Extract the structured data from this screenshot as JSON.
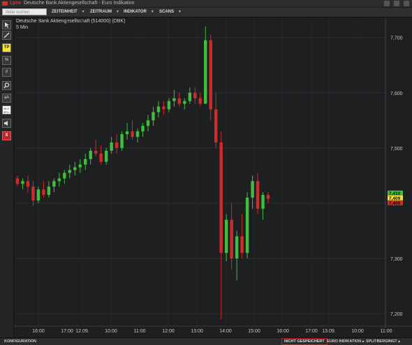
{
  "app": {
    "brand": "Lynx",
    "window_title": "Deutsche Bank Aktiengesellschaft - Euro Indikation"
  },
  "toolbar": {
    "search_placeholder": "Aktie suchen",
    "menus": [
      {
        "label": "ZEITEINHEIT"
      },
      {
        "label": "ZEITRAUM"
      },
      {
        "label": "INDIKATOR"
      },
      {
        "label": "SCANS"
      }
    ]
  },
  "sidebar": {
    "buttons": [
      {
        "label": "",
        "icon": "cursor-icon"
      },
      {
        "label": "",
        "icon": "line-tool-icon"
      },
      {
        "label": "TP",
        "icon": "tp-icon",
        "highlight": "#f4e23a"
      },
      {
        "label": "%",
        "icon": "percent-tool-icon"
      },
      {
        "label": "//",
        "icon": "parallel-lines-icon"
      },
      {
        "label": "",
        "icon": "zoom-icon"
      },
      {
        "label": "aA",
        "icon": "text-tool-icon"
      },
      {
        "label": "BUY SELL",
        "icon": "buy-sell-icon"
      },
      {
        "label": "",
        "icon": "sound-icon"
      },
      {
        "label": "X",
        "icon": "close-icon",
        "highlight": "#c0272d"
      }
    ]
  },
  "chart": {
    "title": "Deutsche Bank Aktiengesellschaft (514000) (DBK)",
    "subtitle": "5 Min"
  },
  "chart_data": {
    "type": "candlestick",
    "ylim": [
      7.18,
      7.735
    ],
    "y_ticks": [
      7.2,
      7.3,
      7.4,
      7.5,
      7.6,
      7.7
    ],
    "y_tick_labels": [
      "7,200",
      "7,300",
      "7,400",
      "7,500",
      "7,600",
      "7,700"
    ],
    "x_tick_labels": [
      "16:00",
      "17:00",
      "12.09.",
      "10:00",
      "11:00",
      "12:00",
      "13:00",
      "14:00",
      "15:00",
      "16:00",
      "17:00",
      "13.09.",
      "10:00",
      "11:00"
    ],
    "price_labels": [
      {
        "text": "7,410",
        "color": "#3fbf3f"
      },
      {
        "text": "7,409",
        "color": "#f0e030"
      },
      {
        "text": "7,408",
        "color": "#d22a2a"
      }
    ],
    "up_color": "#3fbf3f",
    "down_color": "#d22a2a",
    "candles": [
      [
        7.445,
        7.45,
        7.43,
        7.435
      ],
      [
        7.435,
        7.445,
        7.425,
        7.44
      ],
      [
        7.44,
        7.45,
        7.42,
        7.43
      ],
      [
        7.43,
        7.44,
        7.395,
        7.405
      ],
      [
        7.405,
        7.43,
        7.4,
        7.425
      ],
      [
        7.425,
        7.44,
        7.41,
        7.415
      ],
      [
        7.415,
        7.44,
        7.41,
        7.43
      ],
      [
        7.43,
        7.445,
        7.42,
        7.44
      ],
      [
        7.44,
        7.455,
        7.43,
        7.445
      ],
      [
        7.445,
        7.46,
        7.435,
        7.455
      ],
      [
        7.455,
        7.47,
        7.445,
        7.46
      ],
      [
        7.46,
        7.475,
        7.45,
        7.465
      ],
      [
        7.465,
        7.48,
        7.455,
        7.47
      ],
      [
        7.47,
        7.49,
        7.46,
        7.48
      ],
      [
        7.48,
        7.5,
        7.47,
        7.495
      ],
      [
        7.495,
        7.515,
        7.485,
        7.49
      ],
      [
        7.49,
        7.505,
        7.47,
        7.475
      ],
      [
        7.475,
        7.5,
        7.47,
        7.495
      ],
      [
        7.495,
        7.52,
        7.49,
        7.51
      ],
      [
        7.51,
        7.525,
        7.49,
        7.5
      ],
      [
        7.5,
        7.53,
        7.495,
        7.525
      ],
      [
        7.525,
        7.545,
        7.515,
        7.53
      ],
      [
        7.53,
        7.55,
        7.515,
        7.52
      ],
      [
        7.52,
        7.535,
        7.51,
        7.53
      ],
      [
        7.53,
        7.545,
        7.52,
        7.54
      ],
      [
        7.54,
        7.56,
        7.53,
        7.55
      ],
      [
        7.55,
        7.575,
        7.54,
        7.565
      ],
      [
        7.565,
        7.585,
        7.555,
        7.575
      ],
      [
        7.575,
        7.585,
        7.56,
        7.57
      ],
      [
        7.57,
        7.59,
        7.565,
        7.585
      ],
      [
        7.585,
        7.605,
        7.575,
        7.59
      ],
      [
        7.59,
        7.6,
        7.575,
        7.58
      ],
      [
        7.58,
        7.59,
        7.57,
        7.585
      ],
      [
        7.585,
        7.61,
        7.58,
        7.6
      ],
      [
        7.6,
        7.61,
        7.58,
        7.59
      ],
      [
        7.59,
        7.6,
        7.575,
        7.58
      ],
      [
        7.58,
        7.72,
        7.58,
        7.695
      ],
      [
        7.695,
        7.705,
        7.55,
        7.57
      ],
      [
        7.57,
        7.6,
        7.5,
        7.51
      ],
      [
        7.51,
        7.53,
        7.19,
        7.31
      ],
      [
        7.31,
        7.38,
        7.295,
        7.37
      ],
      [
        7.37,
        7.4,
        7.28,
        7.3
      ],
      [
        7.3,
        7.35,
        7.26,
        7.34
      ],
      [
        7.34,
        7.38,
        7.3,
        7.31
      ],
      [
        7.31,
        7.42,
        7.3,
        7.41
      ],
      [
        7.41,
        7.45,
        7.39,
        7.44
      ],
      [
        7.44,
        7.455,
        7.38,
        7.39
      ],
      [
        7.39,
        7.42,
        7.37,
        7.415
      ],
      [
        7.415,
        7.42,
        7.4,
        7.408
      ]
    ]
  },
  "statusbar": {
    "left": "KONFIGURATION",
    "unsaved": "NICHT GESPEICHERT",
    "mode": "EURO INDIKATION ▴",
    "limit": "SPLITBERGINGT ▴"
  }
}
